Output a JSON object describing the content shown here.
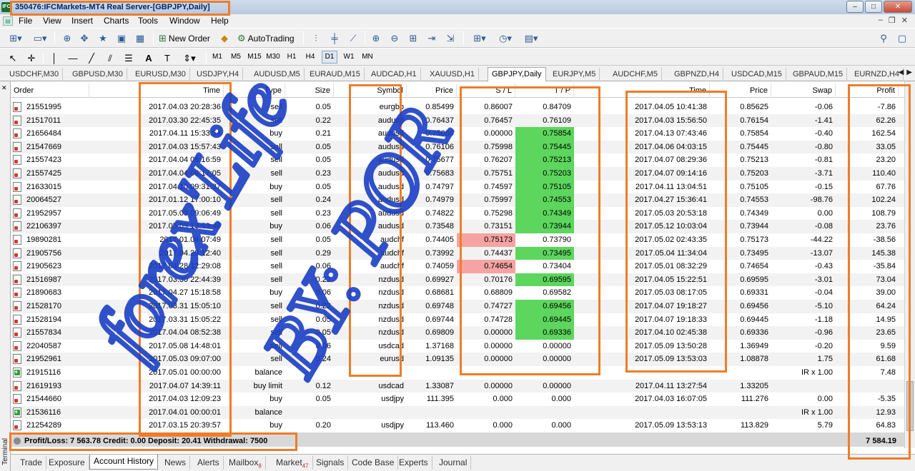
{
  "window": {
    "title": "350476:IFCMarkets-MT4 Real Server-[GBPJPY,Daily]",
    "buttons": [
      "–",
      "□",
      "✕"
    ]
  },
  "menu": [
    "File",
    "View",
    "Insert",
    "Charts",
    "Tools",
    "Window",
    "Help"
  ],
  "toolbar": {
    "new_order": "New Order",
    "auto_trading": "AutoTrading",
    "timeframes": [
      "M1",
      "M5",
      "M15",
      "M30",
      "H1",
      "H4",
      "D1",
      "W1",
      "MN"
    ],
    "active_timeframe": "D1"
  },
  "chart_tabs": [
    "USDCHF,M30",
    "GBPUSD,M30",
    "EURUSD,M30",
    "USDJPY,H4",
    "AUDUSD,M5",
    "EURAUD,M15",
    "AUDCAD,H1",
    "XAUUSD,H1",
    "GBPJPY,Daily",
    "EURJPY,M5",
    "AUDCHF,M5",
    "GBPNZD,H4",
    "USDCAD,M15",
    "GBPAUD,M15",
    "EURNZD,H4"
  ],
  "active_chart_tab": "GBPJPY,Daily",
  "terminal_label": "Terminal",
  "columns": [
    "Order",
    "Time",
    "Type",
    "Size",
    "Symbol",
    "Price",
    "S / L",
    "T / P",
    "Time",
    "Price",
    "Swap",
    "Profit"
  ],
  "rows": [
    {
      "order": "21551995",
      "time": "2017.04.03 20:28:36",
      "type": "sell",
      "size": "0.05",
      "symbol": "eurgbp",
      "price": "0.85499",
      "sl": "0.86007",
      "tp": "0.84709",
      "close_time": "2017.04.05 10:41:38",
      "close_price": "0.85625",
      "swap": "-0.06",
      "profit": "-7.86",
      "hl": ""
    },
    {
      "order": "21517011",
      "time": "2017.03.30 22:45:35",
      "type": "sell",
      "size": "0.22",
      "symbol": "audusd",
      "price": "0.76437",
      "sl": "0.76457",
      "tp": "0.76109",
      "close_time": "2017.04.03 15:56:50",
      "close_price": "0.76154",
      "swap": "-1.41",
      "profit": "62.26",
      "hl": ""
    },
    {
      "order": "21656484",
      "time": "2017.04.11 15:33:54",
      "type": "buy",
      "size": "0.21",
      "symbol": "audusd",
      "price": "0.75080",
      "sl": "0.00000",
      "tp": "0.75854",
      "close_time": "2017.04.13 07:43:46",
      "close_price": "0.75854",
      "swap": "-0.40",
      "profit": "162.54",
      "hl": "tp"
    },
    {
      "order": "21547669",
      "time": "2017.04.03 15:57:43",
      "type": "sell",
      "size": "0.05",
      "symbol": "audusd",
      "price": "0.76106",
      "sl": "0.75998",
      "tp": "0.75445",
      "close_time": "2017.04.06 04:03:15",
      "close_price": "0.75445",
      "swap": "-0.80",
      "profit": "33.05",
      "hl": "tp"
    },
    {
      "order": "21557423",
      "time": "2017.04.04 08:16:59",
      "type": "sell",
      "size": "0.05",
      "symbol": "audusd",
      "price": "0.75677",
      "sl": "0.76207",
      "tp": "0.75213",
      "close_time": "2017.04.07 08:29:36",
      "close_price": "0.75213",
      "swap": "-0.81",
      "profit": "23.20",
      "hl": "tp"
    },
    {
      "order": "21557425",
      "time": "2017.04.04 08:17:05",
      "type": "sell",
      "size": "0.23",
      "symbol": "audusd",
      "price": "0.75683",
      "sl": "0.75751",
      "tp": "0.75203",
      "close_time": "2017.04.07 09:14:16",
      "close_price": "0.75203",
      "swap": "-3.71",
      "profit": "110.40",
      "hl": "tp"
    },
    {
      "order": "21633015",
      "time": "2017.04.10 09:31:37",
      "type": "buy",
      "size": "0.05",
      "symbol": "audusd",
      "price": "0.74797",
      "sl": "0.74597",
      "tp": "0.75105",
      "close_time": "2017.04.11 13:04:51",
      "close_price": "0.75105",
      "swap": "-0.15",
      "profit": "67.76",
      "hl": "tp"
    },
    {
      "order": "20064527",
      "time": "2017.01.12 17:00:10",
      "type": "sell",
      "size": "0.24",
      "symbol": "audusd",
      "price": "0.74979",
      "sl": "0.75997",
      "tp": "0.74553",
      "close_time": "2017.04.27 15:36:41",
      "close_price": "0.74553",
      "swap": "-98.76",
      "profit": "102.24",
      "hl": "tp"
    },
    {
      "order": "21952957",
      "time": "2017.05.03 09:06:49",
      "type": "sell",
      "size": "0.23",
      "symbol": "audusd",
      "price": "0.74822",
      "sl": "0.75298",
      "tp": "0.74349",
      "close_time": "2017.05.03 20:53:18",
      "close_price": "0.74349",
      "swap": "0.00",
      "profit": "108.79",
      "hl": "tp"
    },
    {
      "order": "22106397",
      "time": "2017.05.09 13:53:46",
      "type": "buy",
      "size": "0.06",
      "symbol": "audusd",
      "price": "0.73548",
      "sl": "0.73151",
      "tp": "0.73944",
      "close_time": "2017.05.12 10:03:04",
      "close_price": "0.73944",
      "swap": "-0.08",
      "profit": "23.76",
      "hl": "tp"
    },
    {
      "order": "19890281",
      "time": "2017.01.04 07:49",
      "type": "sell",
      "size": "0.05",
      "symbol": "audchf",
      "price": "0.74405",
      "sl": "0.75173",
      "tp": "0.73790",
      "close_time": "2017.05.02 02:43:35",
      "close_price": "0.75173",
      "swap": "-44.22",
      "profit": "-38.56",
      "hl": "sl"
    },
    {
      "order": "21905756",
      "time": "2017.04.28 12:40",
      "type": "sell",
      "size": "0.29",
      "symbol": "audchf",
      "price": "0.73992",
      "sl": "0.74437",
      "tp": "0.73495",
      "close_time": "2017.05.04 11:34:04",
      "close_price": "0.73495",
      "swap": "-13.07",
      "profit": "145.38",
      "hl": "tp"
    },
    {
      "order": "21905623",
      "time": "2017.04.28 12:29:08",
      "type": "sell",
      "size": "0.06",
      "symbol": "audchf",
      "price": "0.74059",
      "sl": "0.74654",
      "tp": "0.73404",
      "close_time": "2017.05.01 08:32:29",
      "close_price": "0.74654",
      "swap": "-0.43",
      "profit": "-35.84",
      "hl": "sl"
    },
    {
      "order": "21516987",
      "time": "2017.03.30 22:44:39",
      "type": "sell",
      "size": "0.22",
      "symbol": "nzdusd",
      "price": "0.69927",
      "sl": "0.70176",
      "tp": "0.69595",
      "close_time": "2017.04.05 15:22:51",
      "close_price": "0.69595",
      "swap": "-3.01",
      "profit": "73.04",
      "hl": "tp"
    },
    {
      "order": "21890683",
      "time": "2017.04.27 15:18:58",
      "type": "buy",
      "size": "0.06",
      "symbol": "nzdusd",
      "price": "0.68681",
      "sl": "0.68809",
      "tp": "0.69582",
      "close_time": "2017.05.03 08:17:05",
      "close_price": "0.69331",
      "swap": "-0.04",
      "profit": "39.00",
      "hl": ""
    },
    {
      "order": "21528170",
      "time": "2017.03.31 15:05:10",
      "type": "sell",
      "size": "0.22",
      "symbol": "nzdusd",
      "price": "0.69748",
      "sl": "0.74727",
      "tp": "0.69456",
      "close_time": "2017.04.07 19:18:27",
      "close_price": "0.69456",
      "swap": "-5.10",
      "profit": "64.24",
      "hl": "tp"
    },
    {
      "order": "21528194",
      "time": "2017.03.31 15:05:22",
      "type": "sell",
      "size": "0.05",
      "symbol": "nzdusd",
      "price": "0.69744",
      "sl": "0.74728",
      "tp": "0.69445",
      "close_time": "2017.04.07 19:18:33",
      "close_price": "0.69445",
      "swap": "-1.18",
      "profit": "14.95",
      "hl": "tp"
    },
    {
      "order": "21557834",
      "time": "2017.04.04 08:52:38",
      "type": "sell",
      "size": "0.05",
      "symbol": "nzdusd",
      "price": "0.69809",
      "sl": "0.00000",
      "tp": "0.69336",
      "close_time": "2017.04.10 02:45:38",
      "close_price": "0.69336",
      "swap": "-0.96",
      "profit": "23.65",
      "hl": "tp"
    },
    {
      "order": "22040587",
      "time": "2017.05.08 14:48:01",
      "type": "sell",
      "size": "0.06",
      "symbol": "usdcad",
      "price": "1.37168",
      "sl": "0.00000",
      "tp": "0.00000",
      "close_time": "2017.05.09 13:50:28",
      "close_price": "1.36949",
      "swap": "-0.20",
      "profit": "9.59",
      "hl": ""
    },
    {
      "order": "21952961",
      "time": "2017.05.03 09:07:00",
      "type": "sell",
      "size": "0.24",
      "symbol": "eurusd",
      "price": "1.09135",
      "sl": "0.00000",
      "tp": "0.00000",
      "close_time": "2017.05.09 13:53:03",
      "close_price": "1.08878",
      "swap": "1.75",
      "profit": "61.68",
      "hl": ""
    },
    {
      "order": "21915116",
      "time": "2017.05.01 00:00:00",
      "type": "balance",
      "size": "",
      "symbol": "",
      "price": "",
      "sl": "",
      "tp": "",
      "close_time": "",
      "close_price": "",
      "swap": "IR x 1.00",
      "profit": "7.48",
      "hl": "",
      "balance": true
    },
    {
      "order": "21619193",
      "time": "2017.04.07 14:39:11",
      "type": "buy limit",
      "size": "0.12",
      "symbol": "usdcad",
      "price": "1.33087",
      "sl": "0.00000",
      "tp": "0.00000",
      "close_time": "2017.04.11 13:27:54",
      "close_price": "1.33205",
      "swap": "",
      "profit": "",
      "hl": ""
    },
    {
      "order": "21544660",
      "time": "2017.04.03 12:09:23",
      "type": "buy",
      "size": "0.05",
      "symbol": "usdjpy",
      "price": "111.395",
      "sl": "0.000",
      "tp": "0.000",
      "close_time": "2017.04.03 16:07:05",
      "close_price": "111.276",
      "swap": "0.00",
      "profit": "-5.35",
      "hl": ""
    },
    {
      "order": "21536116",
      "time": "2017.04.01 00:00:01",
      "type": "balance",
      "size": "",
      "symbol": "",
      "price": "",
      "sl": "",
      "tp": "",
      "close_time": "",
      "close_price": "",
      "swap": "IR x 1.00",
      "profit": "12.93",
      "hl": "",
      "balance": true
    },
    {
      "order": "21254289",
      "time": "2017.03.15 20:39:57",
      "type": "buy",
      "size": "0.20",
      "symbol": "usdjpy",
      "price": "113.460",
      "sl": "0.000",
      "tp": "0.000",
      "close_time": "2017.05.09 13:53:13",
      "close_price": "113.829",
      "swap": "5.79",
      "profit": "64.83",
      "hl": ""
    }
  ],
  "summary": "Profit/Loss: 7 563.78  Credit: 0.00  Deposit: 20.41  Withdrawal: 7500",
  "total_profit": "7 584.19",
  "bottom_tabs": [
    {
      "label": "Trade",
      "badge": ""
    },
    {
      "label": "Exposure",
      "badge": ""
    },
    {
      "label": "Account History",
      "badge": ""
    },
    {
      "label": "News",
      "badge": ""
    },
    {
      "label": "Alerts",
      "badge": ""
    },
    {
      "label": "Mailbox",
      "badge": "8"
    },
    {
      "label": "Market",
      "badge": "47"
    },
    {
      "label": "Signals",
      "badge": ""
    },
    {
      "label": "Code Base",
      "badge": ""
    },
    {
      "label": "Experts",
      "badge": ""
    },
    {
      "label": "Journal",
      "badge": ""
    }
  ],
  "active_bottom_tab": "Account History",
  "handwriting": [
    "forex'Life",
    "BY: POR"
  ],
  "colors": {
    "highlight_green": "#5cd65c",
    "highlight_red": "#f5a3a3",
    "annotation_orange": "#ef7c29",
    "ink_blue": "#1a3fc4"
  }
}
